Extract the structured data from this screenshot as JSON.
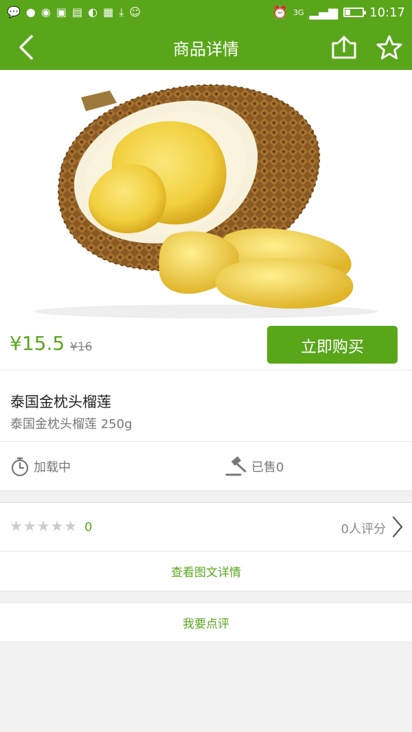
{
  "status_bar": {
    "left_icons": [
      "wechat-icon",
      "qq-icon",
      "weibo-icon",
      "gallery-icon",
      "weather-icon",
      "browser-icon",
      "apps-icon",
      "download-icon",
      "emoji-icon"
    ],
    "network": "3G",
    "time": "10:17"
  },
  "app_bar": {
    "title": "商品详情"
  },
  "product": {
    "price": "¥15.5",
    "original_price": "¥16",
    "buy_label": "立即购买",
    "name": "泰国金枕头榴莲",
    "description": "泰国金枕头榴莲 250g",
    "timer_text": "加载中",
    "sold_text": "已售0"
  },
  "rating": {
    "star_count": 5,
    "filled_stars": 0,
    "score": "0",
    "review_count": "0人评分"
  },
  "links": {
    "detail": "查看图文详情",
    "review": "我要点评"
  },
  "colors": {
    "accent": "#5aa61b",
    "background": "#f2f2f2"
  }
}
